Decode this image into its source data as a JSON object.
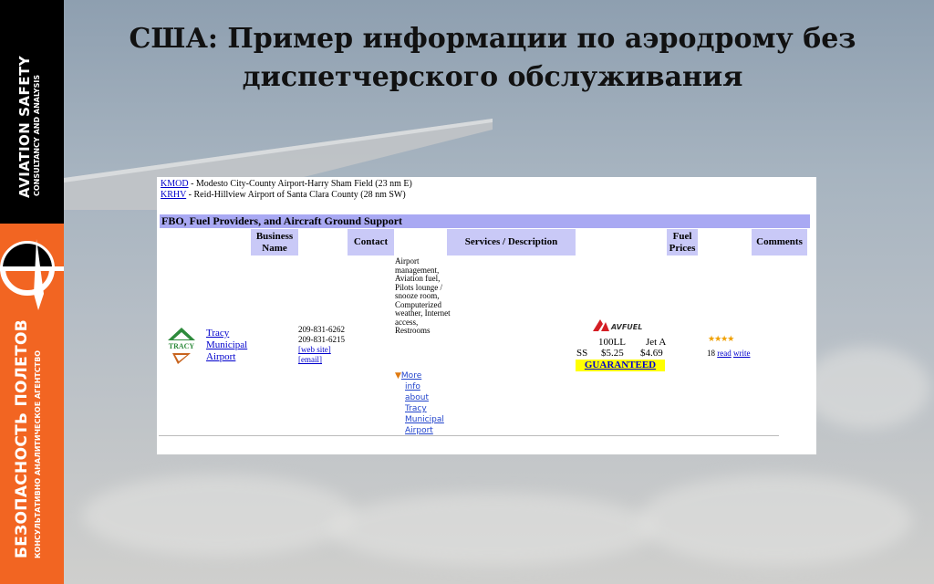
{
  "branding": {
    "en_main": "AVIATION SAFETY",
    "en_sub": "CONSULTANCY AND ANALYSIS",
    "ru_main": "БЕЗОПАСНОСТЬ ПОЛЕТОВ",
    "ru_sub": "КОНСУЛЬТАТИВНО АНАЛИТИЧЕСКОЕ АГЕНТСТВО",
    "colors": {
      "top": "#000000",
      "bottom": "#f26522"
    }
  },
  "slide": {
    "title_line1": "США: Пример информации по аэродрому без",
    "title_line2": "диспетчерского обслуживания"
  },
  "page": {
    "nearby": [
      {
        "code": "KMOD",
        "text": " - Modesto City-County Airport-Harry Sham Field (23 nm E)"
      },
      {
        "code": "KRHV",
        "text": " - Reid-Hillview Airport of Santa Clara County (28 nm SW)"
      }
    ],
    "section_title": "FBO, Fuel Providers, and Aircraft Ground Support",
    "columns": {
      "business": "Business Name",
      "contact": "Contact",
      "services": "Services / Description",
      "fuel": "Fuel Prices",
      "comments": "Comments"
    },
    "row": {
      "logo_text": "TRACY",
      "name_lines": [
        "Tracy",
        "Municipal",
        "Airport"
      ],
      "phone1": "209-831-6262",
      "phone2": "209-831-6215",
      "web_site": "[web site]",
      "email": "[email]",
      "services_text": "Airport management, Aviation fuel, Pilots lounge / snooze room, Computerized weather, Internet access, Restrooms",
      "more_info_lines": [
        "More",
        "info",
        "about",
        "Tracy",
        "Municipal",
        "Airport"
      ],
      "fuel_brand": "AVFUEL",
      "fuel_service": "SS",
      "fuel_grade1": "100LL",
      "fuel_grade2": "Jet A",
      "price1": "$5.25",
      "price2": "$4.69",
      "guaranteed": "GUARANTEED",
      "stars": "★★★★",
      "star_rating": 4.5,
      "review_count": "18",
      "read": "read",
      "write": "write"
    }
  }
}
